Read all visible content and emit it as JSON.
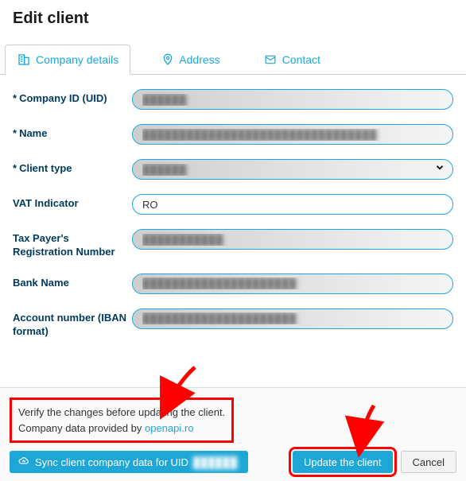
{
  "header": {
    "title": "Edit client"
  },
  "tabs": [
    {
      "label": "Company details",
      "icon": "building-icon",
      "active": true
    },
    {
      "label": "Address",
      "icon": "map-pin-icon",
      "active": false
    },
    {
      "label": "Contact",
      "icon": "envelope-icon",
      "active": false
    }
  ],
  "form": {
    "company_uid": {
      "label": "Company ID (UID)",
      "value": "██████",
      "required": true
    },
    "name": {
      "label": "Name",
      "value": "████████████████████████████████",
      "required": true
    },
    "client_type": {
      "label": "Client type",
      "value": "██████",
      "required": true
    },
    "vat_indicator": {
      "label": "VAT Indicator",
      "value": "RO",
      "required": false
    },
    "taxpayer_reg": {
      "label": "Tax Payer's Registration Number",
      "value": "███████████",
      "required": false
    },
    "bank_name": {
      "label": "Bank Name",
      "value": "█████████████████████",
      "required": false
    },
    "account_number": {
      "label": "Account number (IBAN format)",
      "value": "█████████████████████",
      "required": false
    }
  },
  "notice": {
    "line1": "Verify the changes before updating the client.",
    "line2_prefix": "Company data provided by ",
    "link_text": "openapi.ro"
  },
  "actions": {
    "sync_prefix": "Sync client company data for UID ",
    "sync_uid": "██████",
    "update": "Update the client",
    "cancel": "Cancel"
  },
  "colors": {
    "accent": "#1ea7d6",
    "highlight": "#ff0000",
    "label": "#003a5d"
  }
}
